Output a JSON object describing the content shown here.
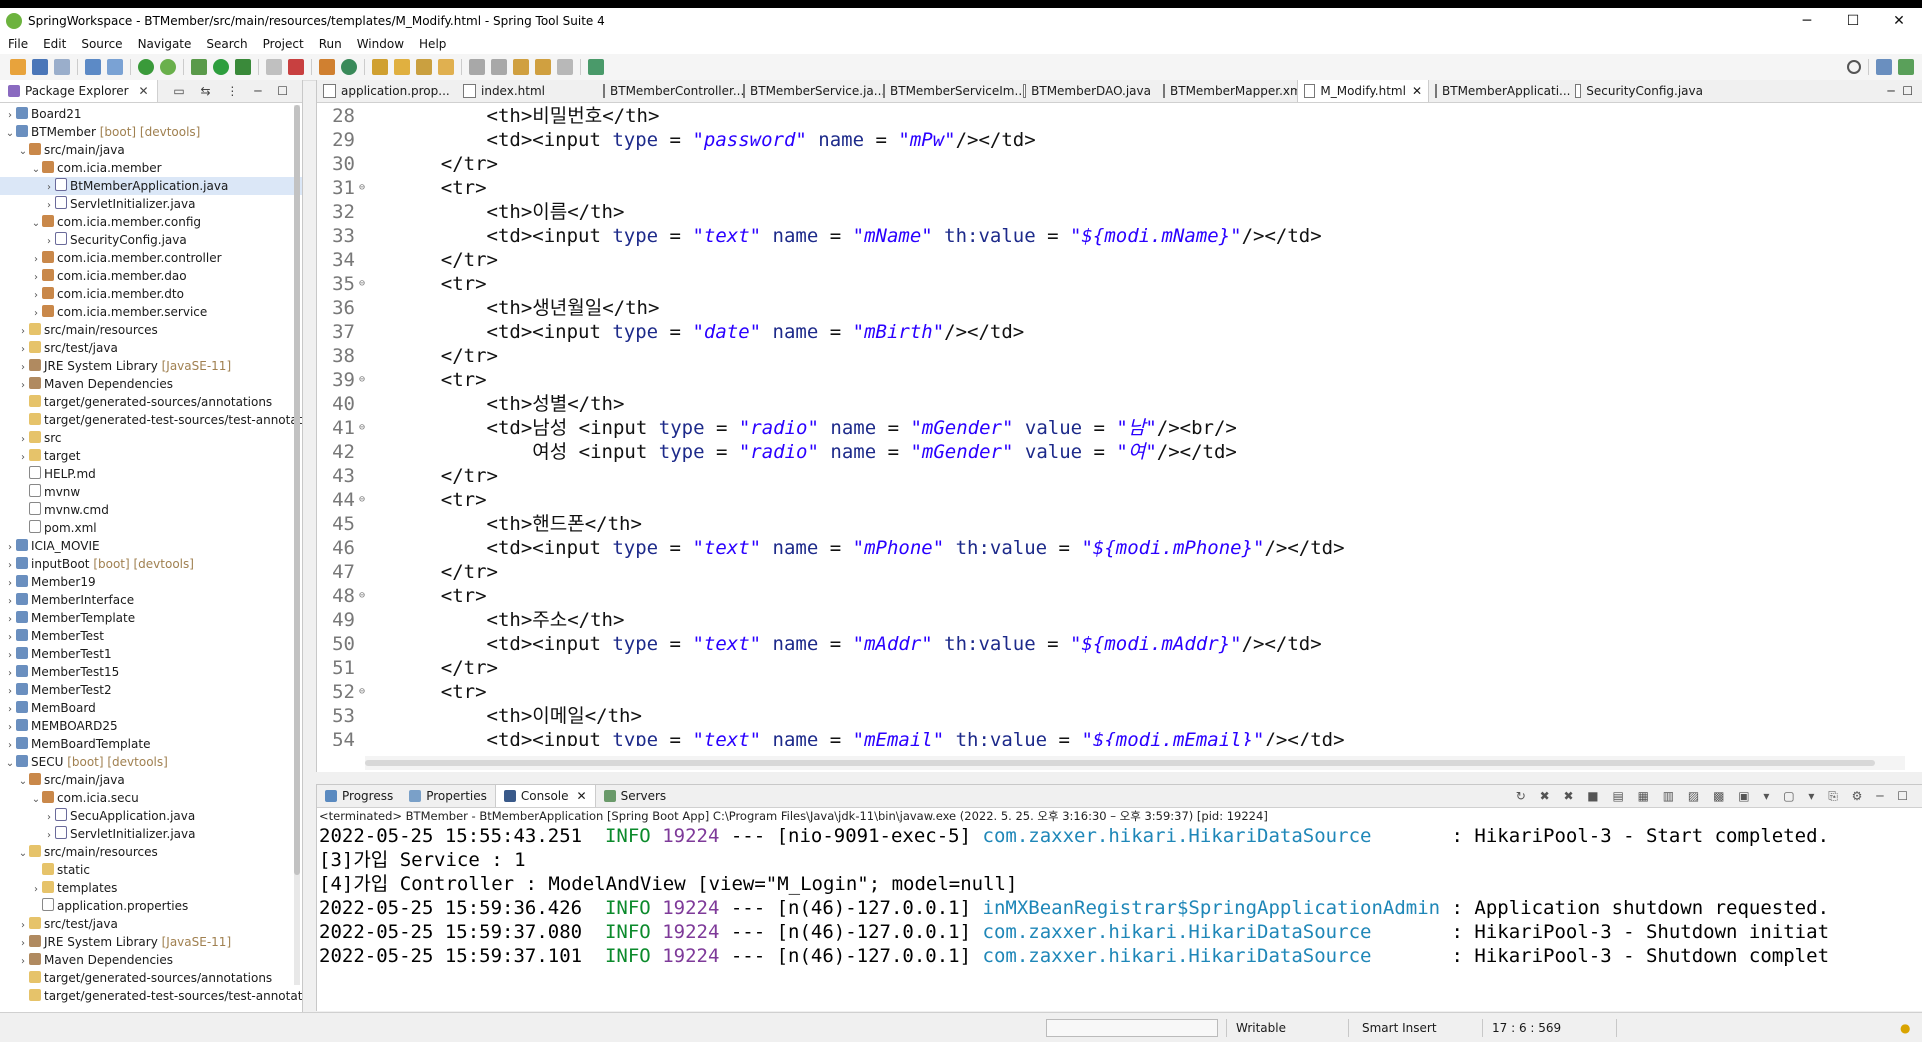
{
  "window": {
    "title": "SpringWorkspace - BTMember/src/main/resources/templates/M_Modify.html - Spring Tool Suite 4",
    "controls": [
      "─",
      "☐",
      "✕"
    ]
  },
  "menu": [
    "File",
    "Edit",
    "Source",
    "Navigate",
    "Search",
    "Project",
    "Run",
    "Window",
    "Help"
  ],
  "package_explorer": {
    "tab_label": "Package Explorer",
    "items": [
      {
        "label": "Board21",
        "deco": "",
        "icon": "proj",
        "arrow": "›",
        "indent": 0
      },
      {
        "label": "BTMember",
        "deco": "[boot] [devtools]",
        "icon": "proj",
        "arrow": "⌄",
        "indent": 0
      },
      {
        "label": "src/main/java",
        "deco": "",
        "icon": "pkg",
        "arrow": "⌄",
        "indent": 1
      },
      {
        "label": "com.icia.member",
        "deco": "",
        "icon": "pkg",
        "arrow": "⌄",
        "indent": 2
      },
      {
        "label": "BtMemberApplication.java",
        "deco": "",
        "icon": "java",
        "arrow": "›",
        "indent": 3,
        "selected": true
      },
      {
        "label": "ServletInitializer.java",
        "deco": "",
        "icon": "java",
        "arrow": "›",
        "indent": 3
      },
      {
        "label": "com.icia.member.config",
        "deco": "",
        "icon": "pkg",
        "arrow": "⌄",
        "indent": 2
      },
      {
        "label": "SecurityConfig.java",
        "deco": "",
        "icon": "java",
        "arrow": "›",
        "indent": 3
      },
      {
        "label": "com.icia.member.controller",
        "deco": "",
        "icon": "pkg",
        "arrow": "›",
        "indent": 2
      },
      {
        "label": "com.icia.member.dao",
        "deco": "",
        "icon": "pkg",
        "arrow": "›",
        "indent": 2
      },
      {
        "label": "com.icia.member.dto",
        "deco": "",
        "icon": "pkg",
        "arrow": "›",
        "indent": 2
      },
      {
        "label": "com.icia.member.service",
        "deco": "",
        "icon": "pkg",
        "arrow": "›",
        "indent": 2
      },
      {
        "label": "src/main/resources",
        "deco": "",
        "icon": "fold",
        "arrow": "›",
        "indent": 1
      },
      {
        "label": "src/test/java",
        "deco": "",
        "icon": "fold",
        "arrow": "›",
        "indent": 1
      },
      {
        "label": "JRE System Library",
        "deco": "[JavaSE-11]",
        "icon": "lib",
        "arrow": "›",
        "indent": 1
      },
      {
        "label": "Maven Dependencies",
        "deco": "",
        "icon": "lib",
        "arrow": "›",
        "indent": 1
      },
      {
        "label": "target/generated-sources/annotations",
        "deco": "",
        "icon": "fold",
        "arrow": "",
        "indent": 1
      },
      {
        "label": "target/generated-test-sources/test-annotatic",
        "deco": "",
        "icon": "fold",
        "arrow": "",
        "indent": 1
      },
      {
        "label": "src",
        "deco": "",
        "icon": "fold",
        "arrow": "›",
        "indent": 1
      },
      {
        "label": "target",
        "deco": "",
        "icon": "fold",
        "arrow": "›",
        "indent": 1
      },
      {
        "label": "HELP.md",
        "deco": "",
        "icon": "file",
        "arrow": "",
        "indent": 1
      },
      {
        "label": "mvnw",
        "deco": "",
        "icon": "file",
        "arrow": "",
        "indent": 1
      },
      {
        "label": "mvnw.cmd",
        "deco": "",
        "icon": "file",
        "arrow": "",
        "indent": 1
      },
      {
        "label": "pom.xml",
        "deco": "",
        "icon": "file",
        "arrow": "",
        "indent": 1
      },
      {
        "label": "ICIA_MOVIE",
        "deco": "",
        "icon": "proj",
        "arrow": "›",
        "indent": 0
      },
      {
        "label": "inputBoot",
        "deco": "[boot] [devtools]",
        "icon": "proj",
        "arrow": "›",
        "indent": 0
      },
      {
        "label": "Member19",
        "deco": "",
        "icon": "proj",
        "arrow": "›",
        "indent": 0
      },
      {
        "label": "MemberInterface",
        "deco": "",
        "icon": "proj",
        "arrow": "›",
        "indent": 0
      },
      {
        "label": "MemberTemplate",
        "deco": "",
        "icon": "proj",
        "arrow": "›",
        "indent": 0
      },
      {
        "label": "MemberTest",
        "deco": "",
        "icon": "proj",
        "arrow": "›",
        "indent": 0
      },
      {
        "label": "MemberTest1",
        "deco": "",
        "icon": "proj",
        "arrow": "›",
        "indent": 0
      },
      {
        "label": "MemberTest15",
        "deco": "",
        "icon": "proj",
        "arrow": "›",
        "indent": 0
      },
      {
        "label": "MemberTest2",
        "deco": "",
        "icon": "proj",
        "arrow": "›",
        "indent": 0
      },
      {
        "label": "MemBoard",
        "deco": "",
        "icon": "proj",
        "arrow": "›",
        "indent": 0
      },
      {
        "label": "MEMBOARD25",
        "deco": "",
        "icon": "proj",
        "arrow": "›",
        "indent": 0
      },
      {
        "label": "MemBoardTemplate",
        "deco": "",
        "icon": "proj",
        "arrow": "›",
        "indent": 0
      },
      {
        "label": "SECU",
        "deco": "[boot] [devtools]",
        "icon": "proj",
        "arrow": "⌄",
        "indent": 0
      },
      {
        "label": "src/main/java",
        "deco": "",
        "icon": "pkg",
        "arrow": "⌄",
        "indent": 1
      },
      {
        "label": "com.icia.secu",
        "deco": "",
        "icon": "pkg",
        "arrow": "⌄",
        "indent": 2
      },
      {
        "label": "SecuApplication.java",
        "deco": "",
        "icon": "java",
        "arrow": "›",
        "indent": 3
      },
      {
        "label": "ServletInitializer.java",
        "deco": "",
        "icon": "java",
        "arrow": "›",
        "indent": 3
      },
      {
        "label": "src/main/resources",
        "deco": "",
        "icon": "fold",
        "arrow": "⌄",
        "indent": 1
      },
      {
        "label": "static",
        "deco": "",
        "icon": "fold",
        "arrow": "",
        "indent": 2
      },
      {
        "label": "templates",
        "deco": "",
        "icon": "fold",
        "arrow": "›",
        "indent": 2
      },
      {
        "label": "application.properties",
        "deco": "",
        "icon": "file",
        "arrow": "",
        "indent": 2
      },
      {
        "label": "src/test/java",
        "deco": "",
        "icon": "fold",
        "arrow": "›",
        "indent": 1
      },
      {
        "label": "JRE System Library",
        "deco": "[JavaSE-11]",
        "icon": "lib",
        "arrow": "›",
        "indent": 1
      },
      {
        "label": "Maven Dependencies",
        "deco": "",
        "icon": "lib",
        "arrow": "›",
        "indent": 1
      },
      {
        "label": "target/generated-sources/annotations",
        "deco": "",
        "icon": "fold",
        "arrow": "",
        "indent": 1
      },
      {
        "label": "target/generated-test-sources/test-annotatic",
        "deco": "",
        "icon": "fold",
        "arrow": "",
        "indent": 1
      }
    ]
  },
  "editor_tabs": [
    {
      "label": "application.prop...",
      "active": false
    },
    {
      "label": "index.html",
      "active": false
    },
    {
      "label": "BTMemberController...",
      "active": false
    },
    {
      "label": "BTMemberService.ja...",
      "active": false
    },
    {
      "label": "BTMemberServiceIm...",
      "active": false
    },
    {
      "label": "BTMemberDAO.java",
      "active": false
    },
    {
      "label": "BTMemberMapper.xml",
      "active": false
    },
    {
      "label": "M_Modify.html",
      "active": true
    },
    {
      "label": "BTMemberApplicati...",
      "active": false
    },
    {
      "label": "SecurityConfig.java",
      "active": false
    }
  ],
  "code_lines": [
    {
      "n": "28",
      "fold": "",
      "parts": [
        [
          "t",
          "        <th>비밀번호</th>"
        ]
      ]
    },
    {
      "n": "29",
      "fold": "",
      "parts": [
        [
          "t",
          "        <td><input "
        ],
        [
          "a",
          "type"
        ],
        [
          "t",
          " = "
        ],
        [
          "s",
          "\"password\""
        ],
        [
          "t",
          " "
        ],
        [
          "a",
          "name"
        ],
        [
          "t",
          " = "
        ],
        [
          "s",
          "\"mPw\""
        ],
        [
          "t",
          "/></td>"
        ]
      ]
    },
    {
      "n": "30",
      "fold": "",
      "parts": [
        [
          "t",
          "    </tr>"
        ]
      ]
    },
    {
      "n": "31",
      "fold": "⊖",
      "parts": [
        [
          "t",
          "    <tr>"
        ]
      ]
    },
    {
      "n": "32",
      "fold": "",
      "parts": [
        [
          "t",
          "        <th>이름</th>"
        ]
      ]
    },
    {
      "n": "33",
      "fold": "",
      "parts": [
        [
          "t",
          "        <td><input "
        ],
        [
          "a",
          "type"
        ],
        [
          "t",
          " = "
        ],
        [
          "s",
          "\"text\""
        ],
        [
          "t",
          " "
        ],
        [
          "a",
          "name"
        ],
        [
          "t",
          " = "
        ],
        [
          "s",
          "\"mName\""
        ],
        [
          "t",
          " "
        ],
        [
          "a",
          "th:value"
        ],
        [
          "t",
          " = "
        ],
        [
          "s",
          "\"${modi.mName}\""
        ],
        [
          "t",
          "/></td>"
        ]
      ]
    },
    {
      "n": "34",
      "fold": "",
      "parts": [
        [
          "t",
          "    </tr>"
        ]
      ]
    },
    {
      "n": "35",
      "fold": "⊖",
      "parts": [
        [
          "t",
          "    <tr>"
        ]
      ]
    },
    {
      "n": "36",
      "fold": "",
      "parts": [
        [
          "t",
          "        <th>생년월일</th>"
        ]
      ]
    },
    {
      "n": "37",
      "fold": "",
      "parts": [
        [
          "t",
          "        <td><input "
        ],
        [
          "a",
          "type"
        ],
        [
          "t",
          " = "
        ],
        [
          "s",
          "\"date\""
        ],
        [
          "t",
          " "
        ],
        [
          "a",
          "name"
        ],
        [
          "t",
          " = "
        ],
        [
          "s",
          "\"mBirth\""
        ],
        [
          "t",
          "/></td>"
        ]
      ]
    },
    {
      "n": "38",
      "fold": "",
      "parts": [
        [
          "t",
          "    </tr>"
        ]
      ]
    },
    {
      "n": "39",
      "fold": "⊖",
      "parts": [
        [
          "t",
          "    <tr>"
        ]
      ]
    },
    {
      "n": "40",
      "fold": "",
      "parts": [
        [
          "t",
          "        <th>성별</th>"
        ]
      ]
    },
    {
      "n": "41",
      "fold": "⊖",
      "parts": [
        [
          "t",
          "        <td>남성 <input "
        ],
        [
          "a",
          "type"
        ],
        [
          "t",
          " = "
        ],
        [
          "s",
          "\"radio\""
        ],
        [
          "t",
          " "
        ],
        [
          "a",
          "name"
        ],
        [
          "t",
          " = "
        ],
        [
          "s",
          "\"mGender\""
        ],
        [
          "t",
          " "
        ],
        [
          "a",
          "value"
        ],
        [
          "t",
          " = "
        ],
        [
          "s",
          "\"남\""
        ],
        [
          "t",
          "/><br/>"
        ]
      ]
    },
    {
      "n": "42",
      "fold": "",
      "parts": [
        [
          "t",
          "            여성 <input "
        ],
        [
          "a",
          "type"
        ],
        [
          "t",
          " = "
        ],
        [
          "s",
          "\"radio\""
        ],
        [
          "t",
          " "
        ],
        [
          "a",
          "name"
        ],
        [
          "t",
          " = "
        ],
        [
          "s",
          "\"mGender\""
        ],
        [
          "t",
          " "
        ],
        [
          "a",
          "value"
        ],
        [
          "t",
          " = "
        ],
        [
          "s",
          "\"여\""
        ],
        [
          "t",
          "/></td>"
        ]
      ]
    },
    {
      "n": "43",
      "fold": "",
      "parts": [
        [
          "t",
          "    </tr>"
        ]
      ]
    },
    {
      "n": "44",
      "fold": "⊖",
      "parts": [
        [
          "t",
          "    <tr>"
        ]
      ]
    },
    {
      "n": "45",
      "fold": "",
      "parts": [
        [
          "t",
          "        <th>핸드폰</th>"
        ]
      ]
    },
    {
      "n": "46",
      "fold": "",
      "parts": [
        [
          "t",
          "        <td><input "
        ],
        [
          "a",
          "type"
        ],
        [
          "t",
          " = "
        ],
        [
          "s",
          "\"text\""
        ],
        [
          "t",
          " "
        ],
        [
          "a",
          "name"
        ],
        [
          "t",
          " = "
        ],
        [
          "s",
          "\"mPhone\""
        ],
        [
          "t",
          " "
        ],
        [
          "a",
          "th:value"
        ],
        [
          "t",
          " = "
        ],
        [
          "s",
          "\"${modi.mPhone}\""
        ],
        [
          "t",
          "/></td>"
        ]
      ]
    },
    {
      "n": "47",
      "fold": "",
      "parts": [
        [
          "t",
          "    </tr>"
        ]
      ]
    },
    {
      "n": "48",
      "fold": "⊖",
      "parts": [
        [
          "t",
          "    <tr>"
        ]
      ]
    },
    {
      "n": "49",
      "fold": "",
      "parts": [
        [
          "t",
          "        <th>주소</th>"
        ]
      ]
    },
    {
      "n": "50",
      "fold": "",
      "parts": [
        [
          "t",
          "        <td><input "
        ],
        [
          "a",
          "type"
        ],
        [
          "t",
          " = "
        ],
        [
          "s",
          "\"text\""
        ],
        [
          "t",
          " "
        ],
        [
          "a",
          "name"
        ],
        [
          "t",
          " = "
        ],
        [
          "s",
          "\"mAddr\""
        ],
        [
          "t",
          " "
        ],
        [
          "a",
          "th:value"
        ],
        [
          "t",
          " = "
        ],
        [
          "s",
          "\"${modi.mAddr}\""
        ],
        [
          "t",
          "/></td>"
        ]
      ]
    },
    {
      "n": "51",
      "fold": "",
      "parts": [
        [
          "t",
          "    </tr>"
        ]
      ]
    },
    {
      "n": "52",
      "fold": "⊖",
      "parts": [
        [
          "t",
          "    <tr>"
        ]
      ]
    },
    {
      "n": "53",
      "fold": "",
      "parts": [
        [
          "t",
          "        <th>이메일</th>"
        ]
      ]
    },
    {
      "n": "54",
      "fold": "",
      "parts": [
        [
          "t",
          "        <td><input "
        ],
        [
          "a",
          "type"
        ],
        [
          "t",
          " = "
        ],
        [
          "s",
          "\"text\""
        ],
        [
          "t",
          " "
        ],
        [
          "a",
          "name"
        ],
        [
          "t",
          " = "
        ],
        [
          "s",
          "\"mEmail\""
        ],
        [
          "t",
          " "
        ],
        [
          "a",
          "th:value"
        ],
        [
          "t",
          " = "
        ],
        [
          "s",
          "\"${modi.mEmail}\""
        ],
        [
          "t",
          "/></td>"
        ]
      ]
    }
  ],
  "console": {
    "tabs": [
      "Progress",
      "Properties",
      "Console",
      "Servers"
    ],
    "active_tab": "Console",
    "terminated": "<terminated> BTMember - BtMemberApplication [Spring Boot App] C:\\Program Files\\Java\\jdk-11\\bin\\javaw.exe  (2022. 5. 25. 오후 3:16:30 – 오후 3:59:37) [pid: 19224]",
    "lines": [
      [
        [
          "n",
          "2022-05-25 15:55:43.251  "
        ],
        [
          "g",
          "INFO"
        ],
        [
          "n",
          " "
        ],
        [
          "p",
          "19224"
        ],
        [
          "n",
          " --- [nio-9091-exec-5] "
        ],
        [
          "c",
          "com.zaxxer.hikari.HikariDataSource      "
        ],
        [
          "n",
          " : HikariPool-3 - Start completed."
        ]
      ],
      [
        [
          "n",
          "[3]가입 Service : 1"
        ]
      ],
      [
        [
          "n",
          "[4]가입 Controller : ModelAndView [view=\"M_Login\"; model=null]"
        ]
      ],
      [
        [
          "n",
          "2022-05-25 15:59:36.426  "
        ],
        [
          "g",
          "INFO"
        ],
        [
          "n",
          " "
        ],
        [
          "p",
          "19224"
        ],
        [
          "n",
          " --- [n(46)-127.0.0.1] "
        ],
        [
          "c",
          "inMXBeanRegistrar$SpringApplicationAdmin"
        ],
        [
          "n",
          " : Application shutdown requested."
        ]
      ],
      [
        [
          "n",
          "2022-05-25 15:59:37.080  "
        ],
        [
          "g",
          "INFO"
        ],
        [
          "n",
          " "
        ],
        [
          "p",
          "19224"
        ],
        [
          "n",
          " --- [n(46)-127.0.0.1] "
        ],
        [
          "c",
          "com.zaxxer.hikari.HikariDataSource      "
        ],
        [
          "n",
          " : HikariPool-3 - Shutdown initiat"
        ]
      ],
      [
        [
          "n",
          "2022-05-25 15:59:37.101  "
        ],
        [
          "g",
          "INFO"
        ],
        [
          "n",
          " "
        ],
        [
          "p",
          "19224"
        ],
        [
          "n",
          " --- [n(46)-127.0.0.1] "
        ],
        [
          "c",
          "com.zaxxer.hikari.HikariDataSource      "
        ],
        [
          "n",
          " : HikariPool-3 - Shutdown complet"
        ]
      ]
    ]
  },
  "status": {
    "writable": "Writable",
    "insert_mode": "Smart Insert",
    "position": "17 : 6 : 569"
  }
}
